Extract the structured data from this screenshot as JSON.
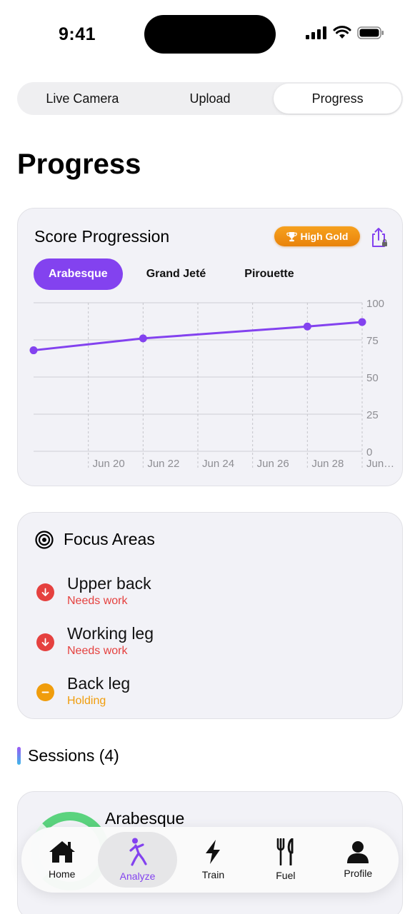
{
  "status_bar": {
    "time": "9:41"
  },
  "segmented": {
    "items": [
      "Live Camera",
      "Upload",
      "Progress"
    ],
    "selected": "Progress"
  },
  "page": {
    "title": "Progress"
  },
  "score_card": {
    "title": "Score Progression",
    "badge": "High Gold",
    "chips": [
      "Arabesque",
      "Grand Jeté",
      "Pirouette"
    ],
    "selected_chip": "Arabesque"
  },
  "chart_data": {
    "type": "line",
    "x": [
      "Jun 18",
      "Jun 22",
      "Jun 28",
      "Jun 30"
    ],
    "values": [
      68,
      76,
      84,
      87
    ],
    "x_tick_labels": [
      "Jun 20",
      "Jun 22",
      "Jun 24",
      "Jun 26",
      "Jun 28",
      "Jun…"
    ],
    "y_ticks": [
      100,
      75,
      50,
      25,
      0
    ],
    "ylim": [
      0,
      100
    ],
    "grid": true,
    "color": "#8342ef"
  },
  "focus": {
    "title": "Focus Areas",
    "items": [
      {
        "name": "Upper back",
        "status": "Needs work",
        "color": "#e5413f"
      },
      {
        "name": "Working leg",
        "status": "Needs work",
        "color": "#e5413f"
      },
      {
        "name": "Back leg",
        "status": "Holding",
        "color": "#f09d0c"
      }
    ]
  },
  "sessions": {
    "title": "Sessions (4)",
    "first_name": "Arabesque"
  },
  "tabbar": {
    "items": [
      {
        "label": "Home",
        "icon": "house-icon"
      },
      {
        "label": "Analyze",
        "icon": "figure-dance-icon"
      },
      {
        "label": "Train",
        "icon": "bolt-icon"
      },
      {
        "label": "Fuel",
        "icon": "fork-knife-icon"
      },
      {
        "label": "Profile",
        "icon": "person-icon"
      }
    ],
    "selected": "Analyze"
  }
}
